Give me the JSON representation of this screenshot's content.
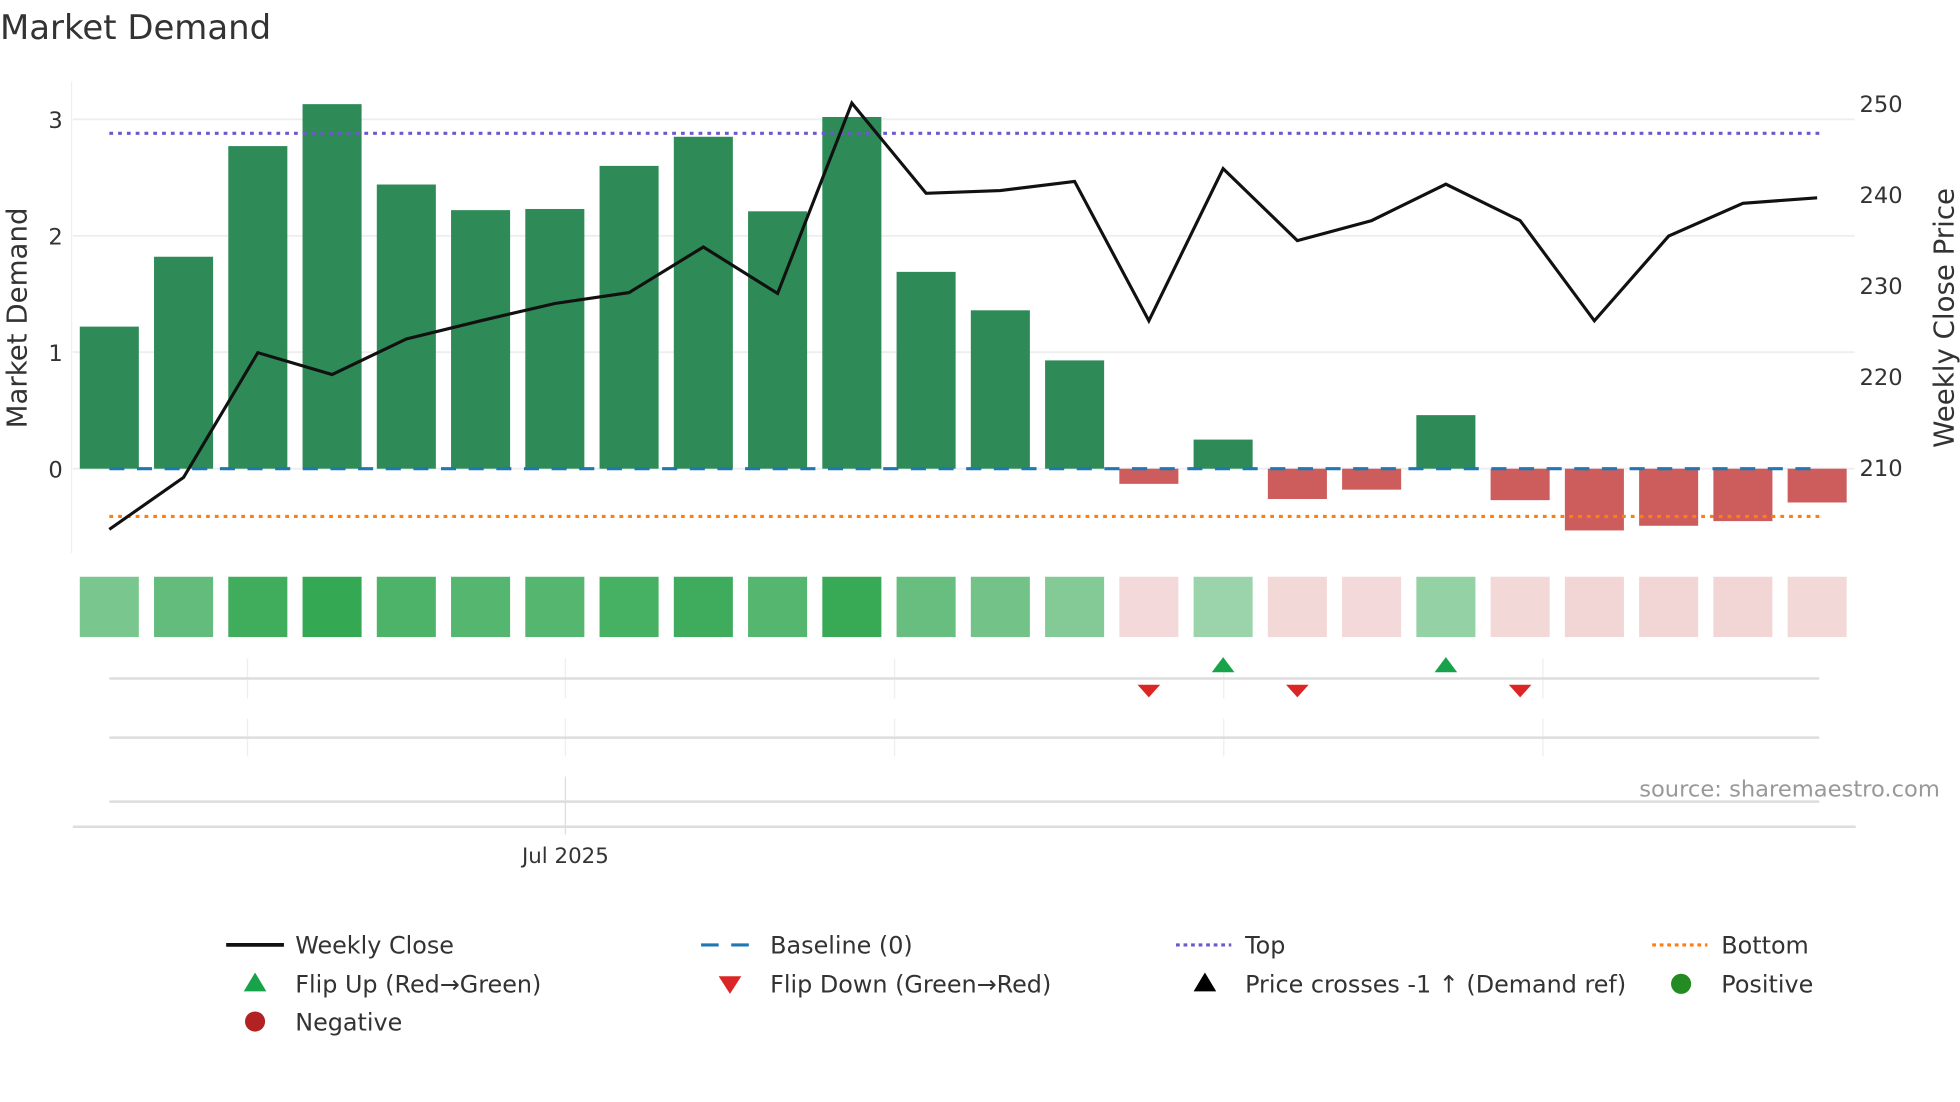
{
  "chart_data": {
    "type": "bar",
    "title": "Market Demand",
    "ylabel": "Market Demand",
    "y2label": "Weekly Close Price",
    "ylim": [
      -0.72,
      3.32
    ],
    "y2lim": [
      199,
      254
    ],
    "yticks": [
      "0",
      "1",
      "2",
      "3"
    ],
    "y2ticks": [
      "210",
      "220",
      "230",
      "240",
      "250"
    ],
    "xtick_label": "Jul 2025",
    "source": "source: sharemaestro.com",
    "demand": [
      1.22,
      1.82,
      2.77,
      3.13,
      2.44,
      2.22,
      2.23,
      2.6,
      2.85,
      2.21,
      3.02,
      1.69,
      1.36,
      0.93,
      -0.13,
      0.25,
      -0.26,
      -0.18,
      0.46,
      -0.27,
      -0.53,
      -0.49,
      -0.45,
      -0.29
    ],
    "weekly_close": [
      203.2,
      208.9,
      222.6,
      220.2,
      224.1,
      226.1,
      228.0,
      229.2,
      234.2,
      229.1,
      250.0,
      240.1,
      240.4,
      241.4,
      226.1,
      242.8,
      234.9,
      237.1,
      241.1,
      237.1,
      226.1,
      235.4,
      239.0,
      239.6
    ],
    "top": 2.88,
    "bottom": -0.41,
    "baseline": 0,
    "flip_up_indices": [
      15,
      18
    ],
    "flip_down_indices": [
      14,
      16,
      19
    ],
    "colors": {
      "positive": "#2e8b57",
      "negative": "#cd5c5c",
      "line": "#111111",
      "baseline": "#1f77b4",
      "top": "#6a5acd",
      "bottom": "#ff7f0e",
      "flip_up": "#16a34a",
      "flip_down": "#dc2626"
    },
    "legend": [
      {
        "label": "Weekly Close",
        "kind": "line",
        "color": "#111111"
      },
      {
        "label": "Baseline (0)",
        "kind": "dash",
        "color": "#1f77b4"
      },
      {
        "label": "Top",
        "kind": "dot",
        "color": "#6a5acd"
      },
      {
        "label": "Bottom",
        "kind": "dot",
        "color": "#ff7f0e"
      },
      {
        "label": "Flip Up (Red→Green)",
        "kind": "tri-up",
        "color": "#16a34a"
      },
      {
        "label": "Flip Down (Green→Red)",
        "kind": "tri-down",
        "color": "#dc2626"
      },
      {
        "label": "Price crosses -1 ↑ (Demand ref)",
        "kind": "tri-up",
        "color": "#000000"
      },
      {
        "label": "Positive",
        "kind": "circle",
        "color": "#228b22"
      },
      {
        "label": "Negative",
        "kind": "circle",
        "color": "#b22222"
      }
    ],
    "legend_position": "bottom"
  }
}
